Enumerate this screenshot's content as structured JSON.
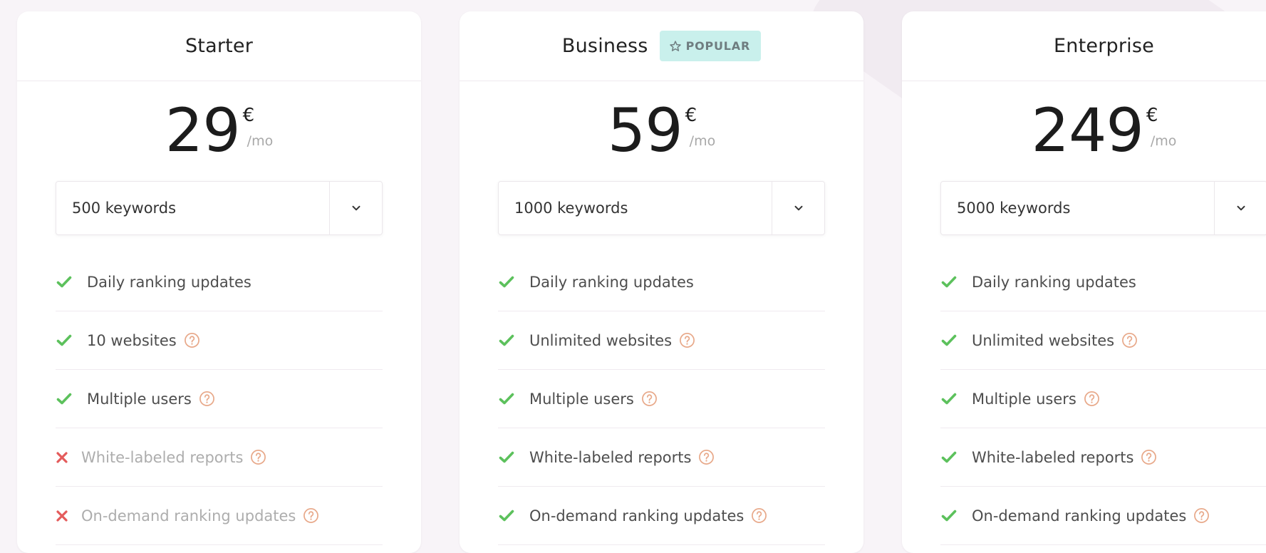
{
  "colors": {
    "check": "#5cc15c",
    "cross": "#e45b5b",
    "help": "#e8a98a",
    "badge_bg": "#c9f0ec"
  },
  "plans": [
    {
      "name": "Starter",
      "price": "29",
      "currency": "€",
      "period": "/mo",
      "keywords": "500 keywords",
      "features": [
        {
          "label": "Daily ranking updates",
          "included": true,
          "help": false
        },
        {
          "label": "10 websites",
          "included": true,
          "help": true
        },
        {
          "label": "Multiple users",
          "included": true,
          "help": true
        },
        {
          "label": "White-labeled reports",
          "included": false,
          "help": true
        },
        {
          "label": "On-demand ranking updates",
          "included": false,
          "help": true
        }
      ]
    },
    {
      "name": "Business",
      "badge": "POPULAR",
      "badge_icon": "star-outline-icon",
      "price": "59",
      "currency": "€",
      "period": "/mo",
      "keywords": "1000 keywords",
      "features": [
        {
          "label": "Daily ranking updates",
          "included": true,
          "help": false
        },
        {
          "label": "Unlimited websites",
          "included": true,
          "help": true
        },
        {
          "label": "Multiple users",
          "included": true,
          "help": true
        },
        {
          "label": "White-labeled reports",
          "included": true,
          "help": true
        },
        {
          "label": "On-demand ranking updates",
          "included": true,
          "help": true
        }
      ]
    },
    {
      "name": "Enterprise",
      "price": "249",
      "currency": "€",
      "period": "/mo",
      "keywords": "5000 keywords",
      "features": [
        {
          "label": "Daily ranking updates",
          "included": true,
          "help": false
        },
        {
          "label": "Unlimited websites",
          "included": true,
          "help": true
        },
        {
          "label": "Multiple users",
          "included": true,
          "help": true
        },
        {
          "label": "White-labeled reports",
          "included": true,
          "help": true
        },
        {
          "label": "On-demand ranking updates",
          "included": true,
          "help": true
        }
      ]
    }
  ]
}
